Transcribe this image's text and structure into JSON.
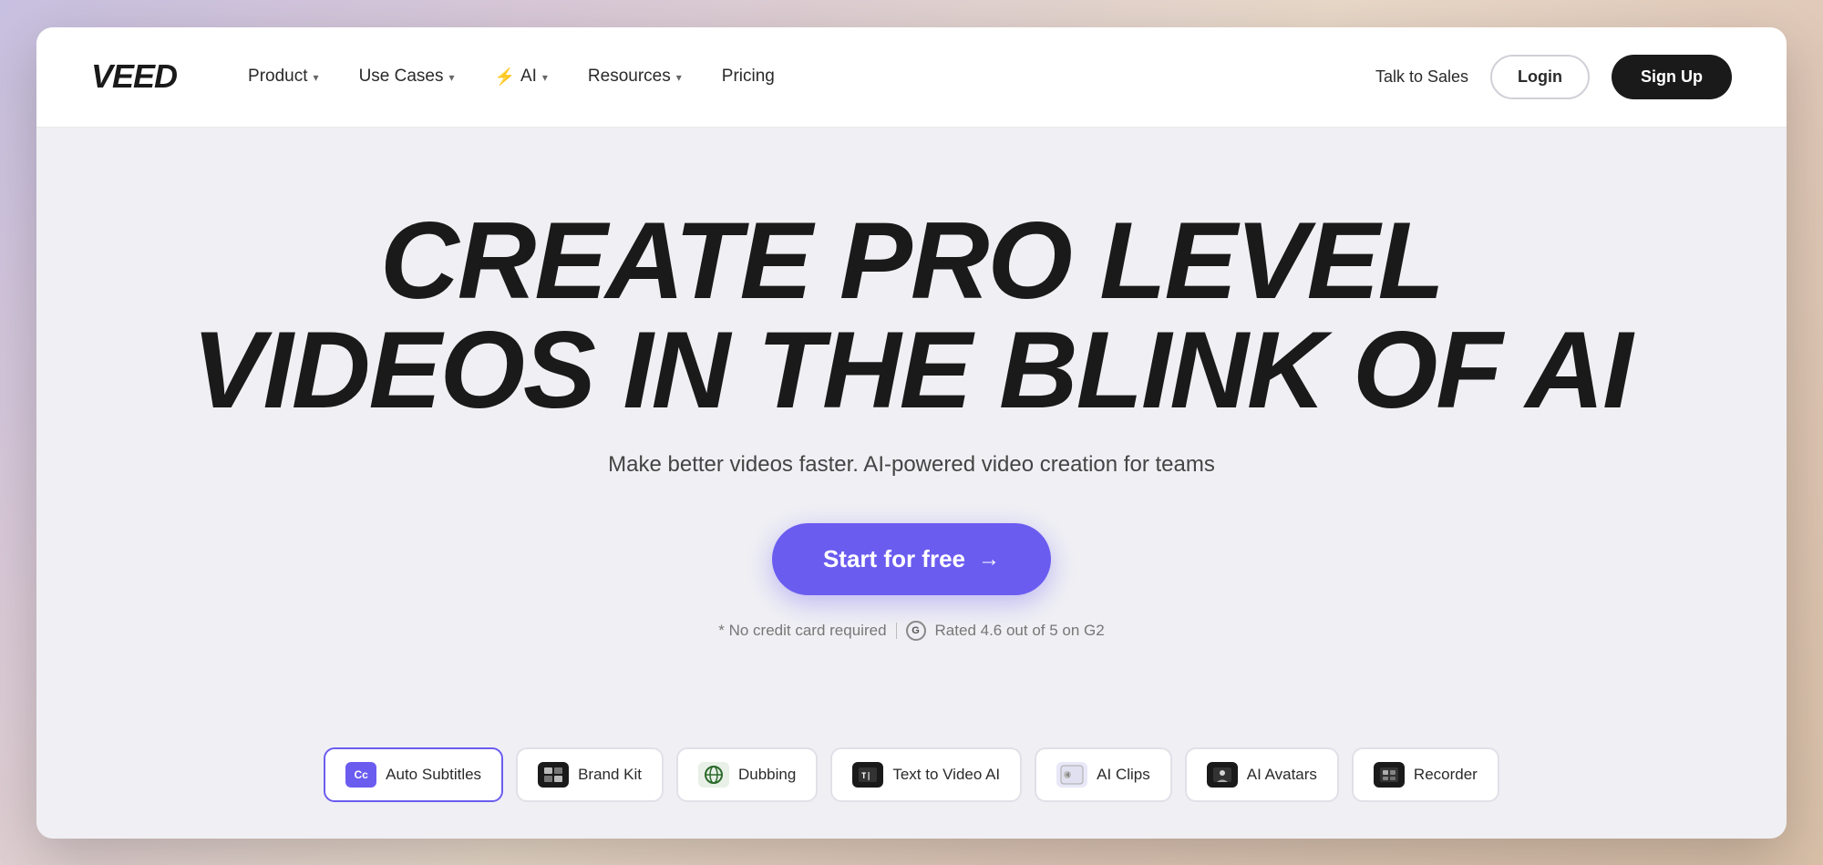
{
  "logo": {
    "text": "VEED"
  },
  "nav": {
    "product": "Product",
    "use_cases": "Use Cases",
    "ai": "AI",
    "resources": "Resources",
    "pricing": "Pricing",
    "talk_to_sales": "Talk to Sales",
    "login": "Login",
    "signup": "Sign Up"
  },
  "hero": {
    "title_line1": "CREATE PRO LEVEL",
    "title_line2": "VIDEOS IN THE BLINK OF AI",
    "subtitle": "Make better videos faster. AI-powered video creation for teams",
    "cta_button": "Start for free",
    "no_cc": "* No credit card required",
    "rated": "Rated 4.6 out of 5 on G2"
  },
  "features": [
    {
      "id": "auto-subtitles",
      "label": "Auto Subtitles",
      "icon": "Cc",
      "active": true
    },
    {
      "id": "brand-kit",
      "label": "Brand Kit",
      "icon": "BK",
      "active": false
    },
    {
      "id": "dubbing",
      "label": "Dubbing",
      "icon": "🌐",
      "active": false
    },
    {
      "id": "text-to-video",
      "label": "Text to Video AI",
      "icon": "T|",
      "active": false
    },
    {
      "id": "ai-clips",
      "label": "AI Clips",
      "icon": "✉",
      "active": false
    },
    {
      "id": "ai-avatars",
      "label": "AI Avatars",
      "icon": "👤",
      "active": false
    },
    {
      "id": "recorder",
      "label": "Recorder",
      "icon": "⊞",
      "active": false
    }
  ],
  "colors": {
    "accent": "#6b5cf0",
    "dark": "#1a1a1a",
    "text_secondary": "#777777"
  }
}
